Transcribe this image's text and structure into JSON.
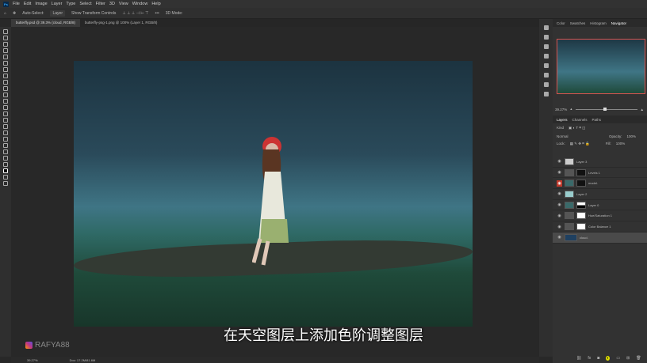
{
  "menu": {
    "items": [
      "File",
      "Edit",
      "Image",
      "Layer",
      "Type",
      "Select",
      "Filter",
      "3D",
      "View",
      "Window",
      "Help"
    ]
  },
  "options": {
    "auto_select": "Auto-Select:",
    "auto_select_target": "Layer",
    "transform": "Show Transform Controls",
    "mode3d": "3D Mode:"
  },
  "tabs": [
    "butterfly.psd @ 39.3% (cloud, RGB/8)",
    "butterfly-psg-1.png @ 100% (Layer 1, RGB/8)"
  ],
  "panels": {
    "top_tabs": [
      "Color",
      "Swatches",
      "Histogram",
      "Navigator"
    ],
    "active_top_tab": "Navigator",
    "nav_zoom": "39.27%",
    "layer_tabs": [
      "Layers",
      "Channels",
      "Paths"
    ],
    "kind": "Kind",
    "blend_mode": "Normal",
    "opacity_label": "Opacity:",
    "opacity": "100%",
    "lock_label": "Lock:",
    "fill_label": "Fill:",
    "fill": "100%",
    "layers": [
      {
        "name": "Layer 3",
        "visible": true
      },
      {
        "name": "Levels 1",
        "visible": true
      },
      {
        "name": "model.",
        "visible": true,
        "highlighted_eye": true
      },
      {
        "name": "Layer 2",
        "visible": true
      },
      {
        "name": "Layer 0",
        "visible": true
      },
      {
        "name": "Hue/Saturation 1",
        "visible": true
      },
      {
        "name": "Color Balance 1",
        "visible": true
      },
      {
        "name": "cloud.",
        "visible": true,
        "selected": true
      }
    ]
  },
  "subtitle": "在天空图层上添加色阶调整图层",
  "watermark": "RAFYA88",
  "status": {
    "zoom": "39.27%",
    "doc": "Doc: 17.2M/81.6M"
  },
  "colors": {
    "accent_red": "#d9534f"
  }
}
